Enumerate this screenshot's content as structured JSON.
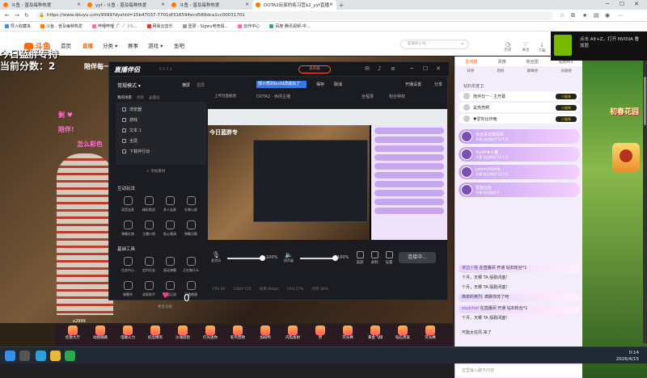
{
  "browser": {
    "tabs": [
      {
        "label": "斗鱼 - 普及每种热爱",
        "active": false
      },
      {
        "label": "yyf - 斗鱼 - 普及每种热爱",
        "active": false
      },
      {
        "label": "斗鱼 - 普及每种热爱",
        "active": false
      },
      {
        "label": "DOTA2玩家的练习营$2_yyf直播",
        "active": true
      }
    ],
    "new_tab_icon": "+",
    "url": "https://www.douyu.com/9999?dyshid=15b47037-7701df316594ecd589dca1cc00031701",
    "bookmarks": [
      "导入收藏夹",
      "斗鱼 - 普及每种热爱",
      "哔哩哔哩（゜-゜)つ...",
      "网易云音乐",
      "登录 - Sigwu电竞俱...",
      "创作中心",
      "百度 腾讯视频-中..."
    ]
  },
  "site": {
    "logo": "斗鱼",
    "nav": [
      {
        "label": "首页",
        "active": false
      },
      {
        "label": "直播",
        "active": true
      },
      {
        "label": "分类 ▾",
        "active": false
      },
      {
        "label": "赛事",
        "active": false
      },
      {
        "label": "游戏 ▾",
        "active": false
      },
      {
        "label": "鱼吧",
        "active": false
      }
    ],
    "search_placeholder": "新来的小鸟",
    "header_icons": [
      {
        "icon": "history-icon",
        "label": "历史"
      },
      {
        "icon": "follow-icon",
        "label": "关注"
      },
      {
        "icon": "download-icon",
        "label": "下载"
      }
    ]
  },
  "stream": {
    "overlay_line1": "今日蓝胖专持",
    "overlay_line2": "当前分数：2",
    "streamer_name": "陪伴每一",
    "pink_line1": "剩 ♥",
    "pink_line2": "陪伴!",
    "pink_line3": "怎么彩色",
    "score_label": "0",
    "gift_count": "x2999",
    "gifts": [
      "伦敦大厅",
      "动感跳跳",
      "电磁火力",
      "纪念精英",
      "沙滩逛街",
      "打光迷你",
      "鸵鸟营救",
      "加班鸭",
      "闪电发射",
      "赞",
      "荧光棒",
      "黄金飞翔",
      "钻石贵族",
      "荧光棒"
    ]
  },
  "obs": {
    "logo": "直播伴侣",
    "version": "6.5.7.1",
    "upgrade": "去升级",
    "mode": "常规模式 ▾",
    "orientation": [
      "横屏",
      "竖屏"
    ],
    "scene_tabs": [
      "我的场景",
      "场景",
      "画面设"
    ],
    "sources": [
      "浏览器",
      "游戏",
      "文本 1",
      "全屏",
      "下载伴行动"
    ],
    "add_source": "+ 添加素材",
    "section_interact": "互动玩法",
    "interact_tools": [
      "语音连麦",
      "精彩挑战",
      "多人连麦",
      "礼物公屏",
      "弹幕礼物",
      "主播口袋",
      "贴心邀请",
      "弹幕点歌"
    ],
    "section_basic": "基础工具",
    "basic_tools": [
      "任务中心",
      "定时任务",
      "滚动弹幕",
      "正在做什么",
      "弹幕秀",
      "录屏助手",
      "观看记录",
      "下播感谢"
    ],
    "more": "更多功能",
    "title_chip": "部小煮的build改装玩了",
    "save": "保存",
    "cancel": "取消",
    "live_settings": "开播设置",
    "share": "分享",
    "cover_label": "上传封面截图",
    "category": "DOTA2 - 休闲主播",
    "full_record": "全程录",
    "fans": "粉丝特权",
    "preview_text": "今日蓝胖专",
    "mic_label": "麦克风",
    "mic_pct": "100%",
    "speaker_label": "扬声器",
    "speaker_pct": "100%",
    "actions": [
      {
        "icon": "beauty-icon",
        "label": "美颜"
      },
      {
        "icon": "record-icon",
        "label": "录制"
      },
      {
        "icon": "settings-icon",
        "label": "设置"
      }
    ],
    "go_live": "连接中...",
    "status": [
      "FPS:60",
      "1280*720",
      "码率:0kbps",
      "CPU:17%",
      "内存:30%"
    ]
  },
  "chat": {
    "tabs": [
      {
        "label": "在线榜",
        "active": true
      },
      {
        "label": "贵族",
        "active": false
      },
      {
        "label": "粉丝团",
        "active": false
      },
      {
        "label": "钻粉M3",
        "active": false
      }
    ],
    "rank_labels": [
      "日榜",
      "周榜",
      "巅峰榜",
      "贡献榜"
    ],
    "ranks_header": "钻石年度卫",
    "ranks": [
      {
        "name": "陪伴日一 - 主开幕",
        "badge": "小猫咪"
      },
      {
        "name": "是亮亮啊",
        "badge": "小猫咪"
      },
      {
        "name": "♥爱你比作晚",
        "badge": "小猫咪"
      }
    ],
    "users": [
      {
        "name": "永远喜欢嗅闲花",
        "sub": "开播 钻石粉丝*12个月"
      },
      {
        "name": "Youth♦小鑫",
        "sub": "开通 钻石粉丝*12个月"
      },
      {
        "name": "JohnnyNorth",
        "sub": "开通 钻石粉丝*12个月"
      },
      {
        "name": "爱酱丝粉",
        "sub": "开通 钻石粉丝*1"
      }
    ],
    "messages": [
      {
        "user": "被迫小猫",
        "text": "在直播间 开通 钻石粉丝*1"
      },
      {
        "user": "",
        "text": "个月，天哪 TA 殷勤闭塞！"
      },
      {
        "user": "",
        "text": "个月，天哪 TA 殷勤闭塞！"
      },
      {
        "user": "",
        "text": "简单的英烈: 疯跑你苏了吧"
      },
      {
        "user": "soulchef",
        "text": "在直播间 开通 钻石粉丝*1"
      },
      {
        "user": "",
        "text": "个月，天哪 TA 殷勤闭塞！"
      },
      {
        "user": "",
        "text": "可能太狂风 来了"
      }
    ],
    "input_placeholder": "这里输入聊天内容"
  },
  "nvidia": {
    "text_line1": "点击 Alt+Z，打开 NVIDIA 叠",
    "text_line2": "加层"
  },
  "right_side": {
    "spring_logo": "初春花园"
  },
  "taskbar": {
    "clock_time": "0:14",
    "clock_date": "2026/4/15"
  }
}
